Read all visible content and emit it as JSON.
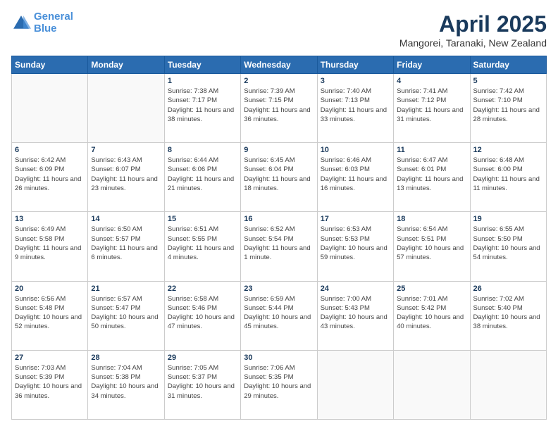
{
  "header": {
    "logo_line1": "General",
    "logo_line2": "Blue",
    "title": "April 2025",
    "subtitle": "Mangorei, Taranaki, New Zealand"
  },
  "weekdays": [
    "Sunday",
    "Monday",
    "Tuesday",
    "Wednesday",
    "Thursday",
    "Friday",
    "Saturday"
  ],
  "weeks": [
    [
      {
        "day": "",
        "info": ""
      },
      {
        "day": "",
        "info": ""
      },
      {
        "day": "1",
        "info": "Sunrise: 7:38 AM\nSunset: 7:17 PM\nDaylight: 11 hours and 38 minutes."
      },
      {
        "day": "2",
        "info": "Sunrise: 7:39 AM\nSunset: 7:15 PM\nDaylight: 11 hours and 36 minutes."
      },
      {
        "day": "3",
        "info": "Sunrise: 7:40 AM\nSunset: 7:13 PM\nDaylight: 11 hours and 33 minutes."
      },
      {
        "day": "4",
        "info": "Sunrise: 7:41 AM\nSunset: 7:12 PM\nDaylight: 11 hours and 31 minutes."
      },
      {
        "day": "5",
        "info": "Sunrise: 7:42 AM\nSunset: 7:10 PM\nDaylight: 11 hours and 28 minutes."
      }
    ],
    [
      {
        "day": "6",
        "info": "Sunrise: 6:42 AM\nSunset: 6:09 PM\nDaylight: 11 hours and 26 minutes."
      },
      {
        "day": "7",
        "info": "Sunrise: 6:43 AM\nSunset: 6:07 PM\nDaylight: 11 hours and 23 minutes."
      },
      {
        "day": "8",
        "info": "Sunrise: 6:44 AM\nSunset: 6:06 PM\nDaylight: 11 hours and 21 minutes."
      },
      {
        "day": "9",
        "info": "Sunrise: 6:45 AM\nSunset: 6:04 PM\nDaylight: 11 hours and 18 minutes."
      },
      {
        "day": "10",
        "info": "Sunrise: 6:46 AM\nSunset: 6:03 PM\nDaylight: 11 hours and 16 minutes."
      },
      {
        "day": "11",
        "info": "Sunrise: 6:47 AM\nSunset: 6:01 PM\nDaylight: 11 hours and 13 minutes."
      },
      {
        "day": "12",
        "info": "Sunrise: 6:48 AM\nSunset: 6:00 PM\nDaylight: 11 hours and 11 minutes."
      }
    ],
    [
      {
        "day": "13",
        "info": "Sunrise: 6:49 AM\nSunset: 5:58 PM\nDaylight: 11 hours and 9 minutes."
      },
      {
        "day": "14",
        "info": "Sunrise: 6:50 AM\nSunset: 5:57 PM\nDaylight: 11 hours and 6 minutes."
      },
      {
        "day": "15",
        "info": "Sunrise: 6:51 AM\nSunset: 5:55 PM\nDaylight: 11 hours and 4 minutes."
      },
      {
        "day": "16",
        "info": "Sunrise: 6:52 AM\nSunset: 5:54 PM\nDaylight: 11 hours and 1 minute."
      },
      {
        "day": "17",
        "info": "Sunrise: 6:53 AM\nSunset: 5:53 PM\nDaylight: 10 hours and 59 minutes."
      },
      {
        "day": "18",
        "info": "Sunrise: 6:54 AM\nSunset: 5:51 PM\nDaylight: 10 hours and 57 minutes."
      },
      {
        "day": "19",
        "info": "Sunrise: 6:55 AM\nSunset: 5:50 PM\nDaylight: 10 hours and 54 minutes."
      }
    ],
    [
      {
        "day": "20",
        "info": "Sunrise: 6:56 AM\nSunset: 5:48 PM\nDaylight: 10 hours and 52 minutes."
      },
      {
        "day": "21",
        "info": "Sunrise: 6:57 AM\nSunset: 5:47 PM\nDaylight: 10 hours and 50 minutes."
      },
      {
        "day": "22",
        "info": "Sunrise: 6:58 AM\nSunset: 5:46 PM\nDaylight: 10 hours and 47 minutes."
      },
      {
        "day": "23",
        "info": "Sunrise: 6:59 AM\nSunset: 5:44 PM\nDaylight: 10 hours and 45 minutes."
      },
      {
        "day": "24",
        "info": "Sunrise: 7:00 AM\nSunset: 5:43 PM\nDaylight: 10 hours and 43 minutes."
      },
      {
        "day": "25",
        "info": "Sunrise: 7:01 AM\nSunset: 5:42 PM\nDaylight: 10 hours and 40 minutes."
      },
      {
        "day": "26",
        "info": "Sunrise: 7:02 AM\nSunset: 5:40 PM\nDaylight: 10 hours and 38 minutes."
      }
    ],
    [
      {
        "day": "27",
        "info": "Sunrise: 7:03 AM\nSunset: 5:39 PM\nDaylight: 10 hours and 36 minutes."
      },
      {
        "day": "28",
        "info": "Sunrise: 7:04 AM\nSunset: 5:38 PM\nDaylight: 10 hours and 34 minutes."
      },
      {
        "day": "29",
        "info": "Sunrise: 7:05 AM\nSunset: 5:37 PM\nDaylight: 10 hours and 31 minutes."
      },
      {
        "day": "30",
        "info": "Sunrise: 7:06 AM\nSunset: 5:35 PM\nDaylight: 10 hours and 29 minutes."
      },
      {
        "day": "",
        "info": ""
      },
      {
        "day": "",
        "info": ""
      },
      {
        "day": "",
        "info": ""
      }
    ]
  ]
}
